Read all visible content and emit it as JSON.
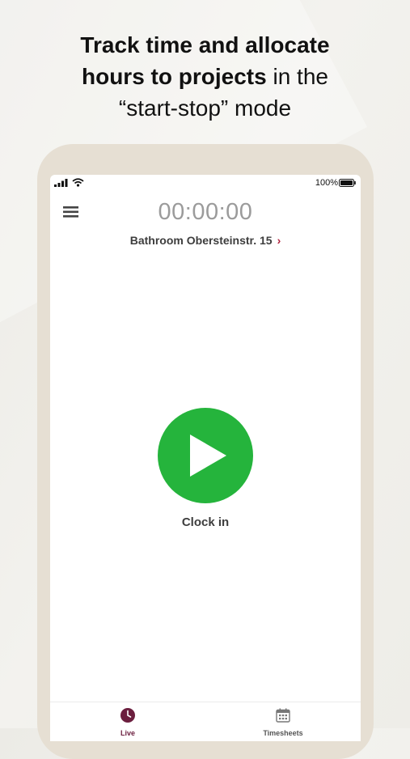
{
  "headline": {
    "bold_line1": "Track time and allocate",
    "bold_line2": "hours to projects",
    "rest_line2": " in the",
    "line3": "“start-stop” mode"
  },
  "status_bar": {
    "battery_percent": "100%"
  },
  "main": {
    "timer": "00:00:00",
    "project": "Bathroom Obersteinstr. 15",
    "clock_label": "Clock in"
  },
  "tabs": [
    {
      "label": "Live",
      "active": true
    },
    {
      "label": "Timesheets",
      "active": false
    }
  ],
  "colors": {
    "accent_green": "#25b43c",
    "active_tab": "#6b1e3e",
    "chevron": "#b0203b"
  },
  "icons": {
    "menu": "hamburger-icon",
    "play": "play-icon",
    "live_tab": "clock-icon",
    "timesheets_tab": "calendar-icon"
  }
}
